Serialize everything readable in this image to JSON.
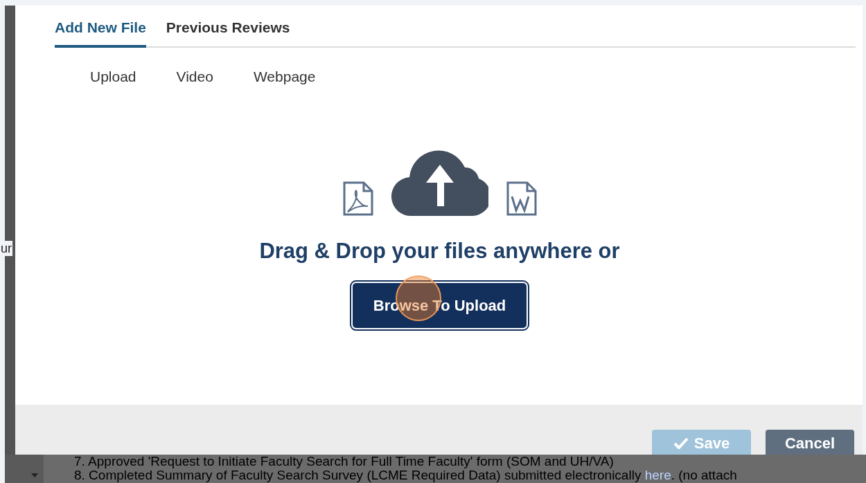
{
  "tabs": [
    {
      "label": "Add New File",
      "selected": true
    },
    {
      "label": "Previous Reviews",
      "selected": false
    }
  ],
  "upload_types": [
    {
      "label": "Upload"
    },
    {
      "label": "Video"
    },
    {
      "label": "Webpage"
    }
  ],
  "dropzone": {
    "heading": "Drag & Drop your files anywhere or",
    "button": "Browse To Upload"
  },
  "footer_buttons": [
    {
      "label": "Save",
      "kind": "save",
      "disabled": true
    },
    {
      "label": "Cancel",
      "kind": "cancel",
      "disabled": false
    }
  ],
  "background": {
    "side_text": "ur",
    "lines": [
      {
        "text": "7. Approved 'Request to Initiate Faculty Search for Full Time Faculty' form (SOM and UH/VA)"
      },
      {
        "text": "8. Completed Summary of Faculty Search Survey (LCME Required Data) submitted electronically ",
        "link": "here",
        "after": ". (no attach"
      }
    ]
  }
}
